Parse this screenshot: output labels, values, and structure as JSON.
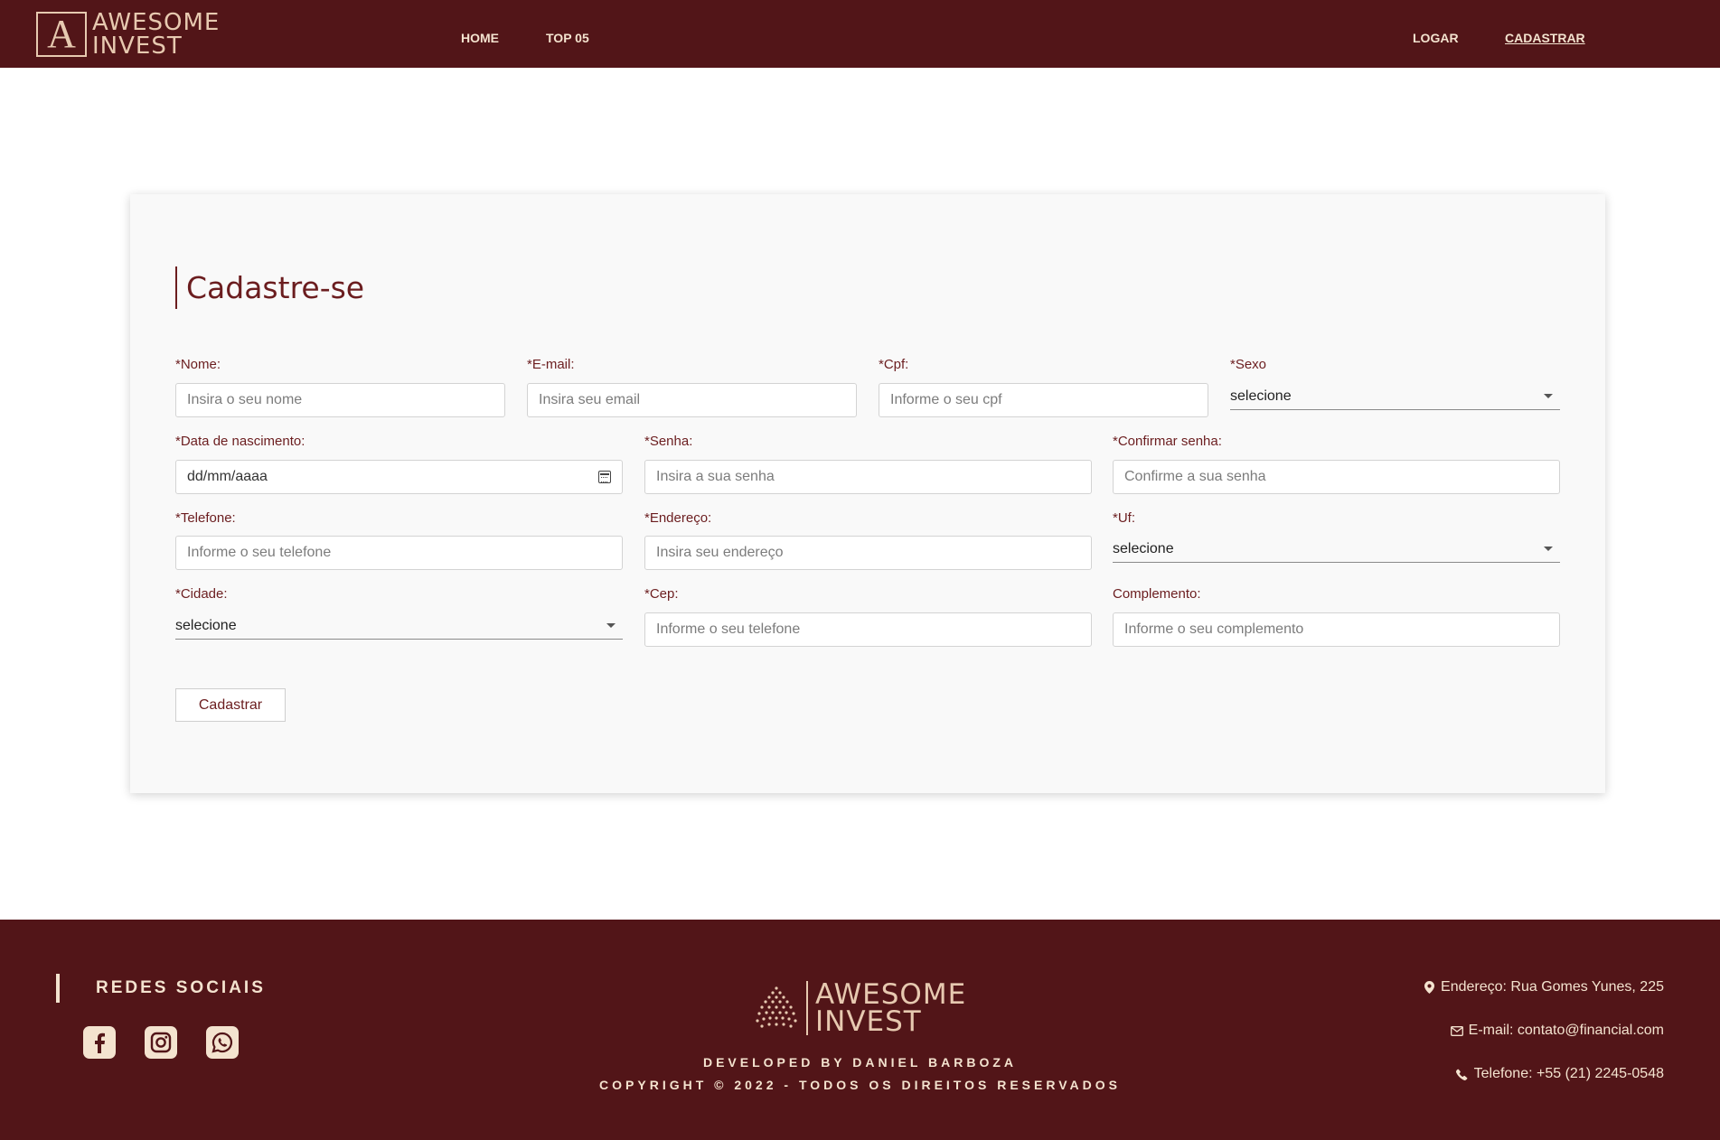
{
  "nav": {
    "logo_letter": "A",
    "logo_line1": "AWESOME",
    "logo_line2": "INVEST",
    "links": [
      "HOME",
      "TOP 05"
    ],
    "right_links": [
      "LOGAR",
      "CADASTRAR"
    ]
  },
  "form": {
    "title": "Cadastre-se",
    "nome": {
      "label": "*Nome:",
      "placeholder": "Insira o seu nome"
    },
    "email": {
      "label": "*E-mail:",
      "placeholder": "Insira seu email"
    },
    "cpf": {
      "label": "*Cpf:",
      "placeholder": "Informe o seu cpf"
    },
    "sexo": {
      "label": "*Sexo",
      "value": "selecione"
    },
    "nascimento": {
      "label": "*Data de nascimento:",
      "value": "dd/mm/aaaa"
    },
    "senha": {
      "label": "*Senha:",
      "placeholder": "Insira a sua senha"
    },
    "confirmar": {
      "label": "*Confirmar senha:",
      "placeholder": "Confirme a sua senha"
    },
    "telefone": {
      "label": "*Telefone:",
      "placeholder": "Informe o seu telefone"
    },
    "endereco": {
      "label": "*Endereço:",
      "placeholder": "Insira seu endereço"
    },
    "uf": {
      "label": "*Uf:",
      "value": "selecione"
    },
    "cidade": {
      "label": "*Cidade:",
      "value": "selecione"
    },
    "cep": {
      "label": "*Cep:",
      "placeholder": "Informe o seu telefone"
    },
    "complemento": {
      "label": "Complemento:",
      "placeholder": "Informe o seu complemento"
    },
    "submit": "Cadastrar"
  },
  "footer": {
    "social_title": "REDES SOCIAIS",
    "logo_line1": "AWESOME",
    "logo_line2": "INVEST",
    "developed": "DEVELOPED BY DANIEL BARBOZA",
    "copyright": "COPYRIGHT © 2022 - TODOS OS DIREITOS RESERVADOS",
    "address": "Endereço: Rua Gomes Yunes, 225",
    "email": "E-mail: contato@financial.com",
    "phone": "Telefone: +55 (21) 2245-0548"
  },
  "colors": {
    "brand": "#521518",
    "accent": "#f4e3cf",
    "text": "#6b1d1f"
  }
}
